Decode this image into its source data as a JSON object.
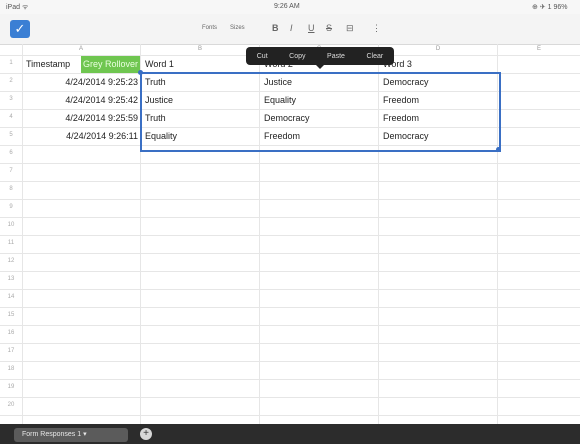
{
  "status_bar": {
    "carrier": "iPad ᯤ",
    "time": "9:26 AM",
    "battery": "⊕ ✈ 1 96%"
  },
  "toolbar": {
    "formula_placeholder": "",
    "font_label": "Fonts",
    "size_label": "Sizes",
    "bold": "B",
    "italic": "I",
    "underline": "U",
    "strike": "S",
    "merge": "⊟",
    "more": "⋮"
  },
  "columns": [
    "A",
    "B",
    "C",
    "D",
    "E"
  ],
  "header_row": [
    "Timestamp",
    "Grey Rollover",
    "Word 1",
    "Word 2",
    "Word 3"
  ],
  "rows": [
    {
      "num": "2",
      "timestamp": "4/24/2014 9:25:23",
      "word1": "Truth",
      "word2": "Justice",
      "word3": "Democracy"
    },
    {
      "num": "3",
      "timestamp": "4/24/2014 9:25:42",
      "word1": "Justice",
      "word2": "Equality",
      "word3": "Freedom"
    },
    {
      "num": "4",
      "timestamp": "4/24/2014 9:25:59",
      "word1": "Truth",
      "word2": "Democracy",
      "word3": "Freedom"
    },
    {
      "num": "5",
      "timestamp": "4/24/2014 9:26:11",
      "word1": "Equality",
      "word2": "Freedom",
      "word3": "Democracy"
    }
  ],
  "row_numbers": [
    "1",
    "2",
    "3",
    "4",
    "5",
    "6",
    "7",
    "8",
    "9",
    "10",
    "11",
    "12",
    "13",
    "14",
    "15",
    "16",
    "17",
    "18",
    "19",
    "20"
  ],
  "context_menu": {
    "cut": "Cut",
    "copy": "Copy",
    "paste": "Paste",
    "clear": "Clear"
  },
  "sheet_tabs": {
    "active": "Form Responses 1 ▾",
    "add": "+"
  },
  "colors": {
    "accent": "#3a6fc4",
    "highlight": "#6fc650"
  }
}
